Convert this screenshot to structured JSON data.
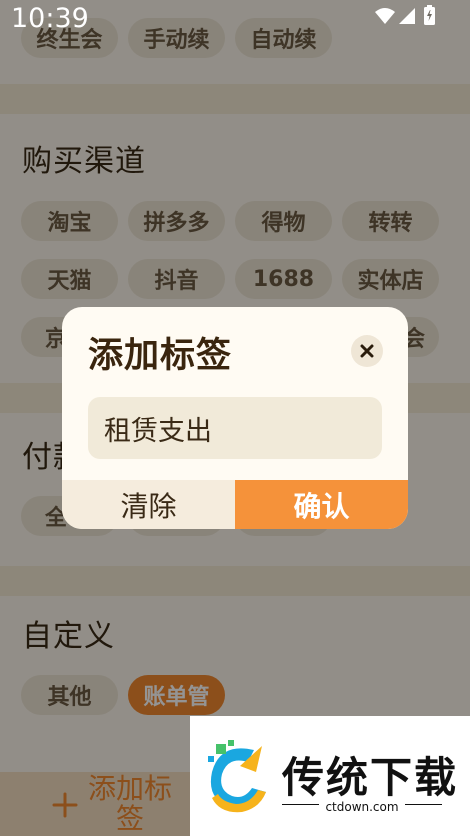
{
  "status_bar": {
    "time": "10:39"
  },
  "sections": {
    "renewal": {
      "chips": [
        "终生会",
        "手动续",
        "自动续"
      ]
    },
    "purchase": {
      "title": "购买渠道",
      "row1": [
        "淘宝",
        "拼多多",
        "得物",
        "转转"
      ],
      "row2": [
        "天猫",
        "抖音",
        "1688",
        "实体店"
      ],
      "row3_left": "京",
      "row3_right": "会"
    },
    "payment": {
      "title_fragment": "付款",
      "chip_fragment": "全"
    },
    "custom": {
      "title": "自定义",
      "chips": [
        "其他",
        "账单管"
      ]
    }
  },
  "add_tag_button": {
    "label_line1": "添加标",
    "label_line2": "签",
    "icon": "plus-icon"
  },
  "dialog": {
    "title": "添加标签",
    "input_value": "租赁支出",
    "clear_label": "清除",
    "confirm_label": "确认",
    "close_icon": "close-icon"
  },
  "ad_banner": {
    "brand": "传统下载",
    "url": "ctdown.com"
  },
  "colors": {
    "accent": "#f5923a",
    "page_bg": "#fbf5ea",
    "chip_bg": "#ece3d2",
    "dialog_bg": "#fffbf3"
  }
}
